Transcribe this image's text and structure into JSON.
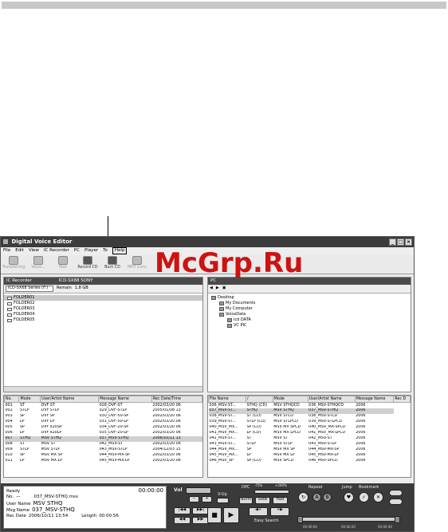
{
  "watermark": "McGrp.Ru",
  "window": {
    "title": "Digital Voice Editor",
    "buttons": [
      "_",
      "□",
      "×"
    ]
  },
  "menu": [
    "File",
    "Edit",
    "View",
    "IC Recorder",
    "PC",
    "Player",
    "To",
    "Help"
  ],
  "toolbar": [
    {
      "label": "Transferring",
      "icon": "transfer-icon",
      "enabled": false
    },
    {
      "label": "Voice...",
      "icon": "voice-icon",
      "enabled": false
    },
    {
      "label": "Mail",
      "icon": "mail-icon",
      "enabled": false
    },
    {
      "label": "Record CD",
      "icon": "record-cd-icon",
      "enabled": true
    },
    {
      "label": "Burn CD",
      "icon": "burn-cd-icon",
      "enabled": true
    },
    {
      "label": "MP3 Conv",
      "icon": "mp3-convert-icon",
      "enabled": false
    }
  ],
  "recorder": {
    "header": "IC Recorder",
    "model": "ICD-SX88 SONY",
    "select": "ICD-SX68 Series (F:)",
    "remain_label": "Remain",
    "remain_value": "1.8 GB",
    "folders": [
      "FOLDER01",
      "FOLDER02",
      "FOLDER03",
      "FOLDER04",
      "FOLDER05"
    ],
    "columns": [
      "No.",
      "Mode",
      "User/Artist Name",
      "Message Name",
      "Rec Date/Time"
    ],
    "rows": [
      [
        "001",
        "ST",
        "DVF ST",
        "028_DVF-ST",
        "2002/03/20 06"
      ],
      [
        "002",
        "STLP",
        "DVF STLP",
        "029_DVF-STLP",
        "2005/01/08 13"
      ],
      [
        "003",
        "SP",
        "DVF SP",
        "030_DVF-50-SP",
        "2002/03/20 06"
      ],
      [
        "004",
        "LP",
        "DVF LP",
        "031_DVF-50-LP",
        "2002/03/20 06"
      ],
      [
        "005",
        "SP",
        "DVF x20SP",
        "034_DVF-20-SP",
        "2002/03/20 06"
      ],
      [
        "006",
        "LP",
        "DVF x20LP",
        "035_DVF-20-LP",
        "2002/03/20 06"
      ],
      [
        "007",
        "STHQ",
        "MSV STHQ",
        "037_MSV-STHQ",
        "2006/10/11 13"
      ],
      [
        "008",
        "ST",
        "MSV ST",
        "042_MSV-ST",
        "2002/03/20 06"
      ],
      [
        "009",
        "STLP",
        "MSV STLP",
        "043_MSV-STLP",
        "2004/12/03 15"
      ],
      [
        "010",
        "SP",
        "MSV MX SP",
        "044_MSV-MX-SP",
        "2002/03/20 06"
      ],
      [
        "011",
        "LP",
        "MSV MX LP",
        "045_MSV-MX-LP",
        "2002/03/20 06"
      ]
    ]
  },
  "pc": {
    "header": "PC",
    "tree": [
      {
        "label": "Desktop",
        "level": 0
      },
      {
        "label": "My Documents",
        "level": 1
      },
      {
        "label": "My Computer",
        "level": 1
      },
      {
        "label": "VoiceData",
        "level": 1
      },
      {
        "label": "icd DATA",
        "level": 2
      },
      {
        "label": "VC PIC",
        "level": 2
      }
    ],
    "columns": [
      "File Name",
      "/",
      "Mode",
      "User/Artist Name",
      "Message Name",
      "Rec D"
    ],
    "rows": [
      [
        "036_MSV-ST...",
        "STHQ (CD)",
        "MSV STHQCD",
        "036_MSV-STHQCD",
        "2006"
      ],
      [
        "037_MSV-ST...",
        "STHQ",
        "MSV STHQ",
        "037_MSV-STHQ",
        "2006"
      ],
      [
        "038_MSV-ST...",
        "ST (CD)",
        "MSV STCD",
        "038_MSV-STCD",
        "2006"
      ],
      [
        "039_MSV-ST...",
        "STLP (CD)",
        "MSV STLPCD",
        "039_MSV-STLPCD",
        "2006"
      ],
      [
        "040_MSV_MX...",
        "SP (CD)",
        "MSV MX SPCD",
        "040_MSV_MX-SPCD",
        "2006"
      ],
      [
        "041_MSV_MX...",
        "LP (CD)",
        "MSV MX LPCD",
        "041_MSV_MX-LPCD",
        "2006"
      ],
      [
        "042_MSV-ST...",
        "ST",
        "MSV ST",
        "042_MSV-ST",
        "2006"
      ],
      [
        "043_MSV-ST...",
        "STLP",
        "MSV STLP",
        "043_MSV-STLP",
        "2006"
      ],
      [
        "044_MSV_MX...",
        "SP",
        "MSV MX SP",
        "044_MSV-MX-SP",
        "2006"
      ],
      [
        "045_MSV_MX...",
        "LP",
        "MSV MX LP",
        "045_MSV-MX-LP",
        "2006"
      ],
      [
        "046_MSV_SP",
        "SP (CD)",
        "MSV SPCD",
        "046_MSV-SPCD",
        "2006"
      ]
    ]
  },
  "player": {
    "status": "Ready",
    "time": "00:00:00",
    "no_label": "No.",
    "no_value": "—",
    "file": "037_MSV-STHQ.msv",
    "user_label": "User Name",
    "user_value": "MSV STHQ",
    "msg_label": "Msg Name",
    "msg_value": "037_MSV-STHQ",
    "date_label": "Rec Date",
    "date_value": "2006/10/11  13:54",
    "length_label": "Length",
    "length_value": "00:00:56",
    "vol_label": "Vol",
    "vup_label": "V-Up",
    "dpc_label": "DPC",
    "dpc_minus": "-75%",
    "dpc_plus": "+200%",
    "norm": "Norm",
    "slow": "Slow",
    "fast": "Fast",
    "easy_search": "Easy Search",
    "repeat_label": "Repeat",
    "a_label": "A",
    "b_label": "B",
    "jump_label": "Jump",
    "bookmark_label": "Bookmark",
    "ticks": [
      "00:00:00",
      "00:00:20",
      "00:00:40"
    ],
    "minus": "−",
    "plus": "+"
  }
}
